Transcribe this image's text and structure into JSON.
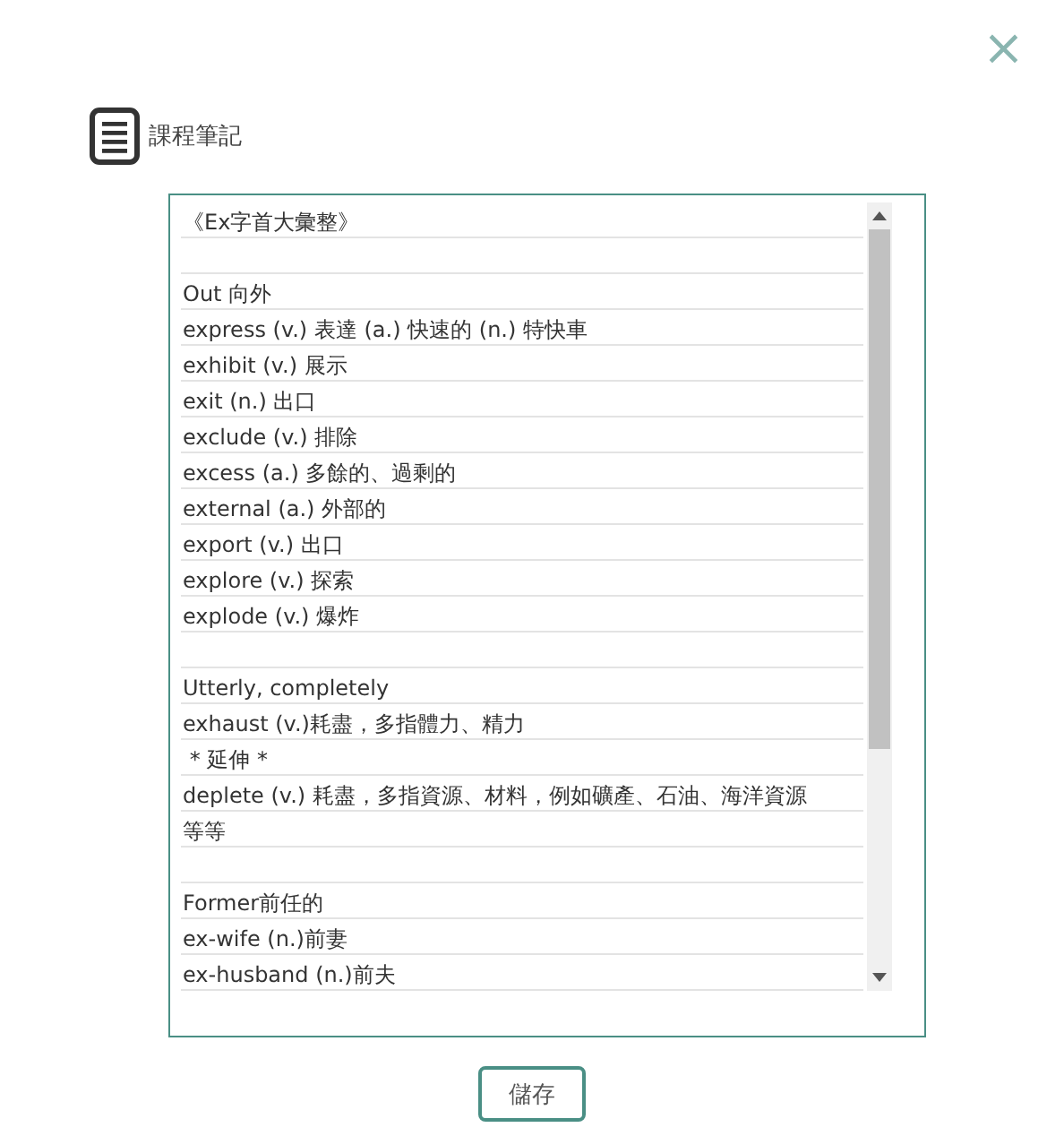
{
  "close_button": {
    "label": "×"
  },
  "header": {
    "title": "課程筆記"
  },
  "note": {
    "lines": [
      {
        "kind": "text",
        "text": "《Ex字首大彙整》"
      },
      {
        "kind": "blank"
      },
      {
        "kind": "text",
        "text": "Out 向外"
      },
      {
        "kind": "text",
        "text": "express (v.) 表達 (a.) 快速的 (n.) 特快車"
      },
      {
        "kind": "text",
        "text": "exhibit (v.) 展示"
      },
      {
        "kind": "text",
        "text": "exit (n.) 出口"
      },
      {
        "kind": "text",
        "text": "exclude (v.) 排除"
      },
      {
        "kind": "text",
        "text": "excess (a.) 多餘的、過剩的"
      },
      {
        "kind": "text",
        "text": "external (a.) 外部的"
      },
      {
        "kind": "text",
        "text": "export (v.) 出口"
      },
      {
        "kind": "text",
        "text": "explore (v.) 探索"
      },
      {
        "kind": "text",
        "text": "explode (v.) 爆炸"
      },
      {
        "kind": "blank"
      },
      {
        "kind": "text",
        "text": "Utterly, completely"
      },
      {
        "kind": "text",
        "text": "exhaust (v.)耗盡，多指體力、精力"
      },
      {
        "kind": "text",
        "text": " * 延伸 *"
      },
      {
        "kind": "text",
        "text": "deplete (v.) 耗盡，多指資源、材料，例如礦產、石油、海洋資源"
      },
      {
        "kind": "text",
        "text": "等等"
      },
      {
        "kind": "blank"
      },
      {
        "kind": "text",
        "text": "Former前任的"
      },
      {
        "kind": "text",
        "text": "ex-wife (n.)前妻"
      },
      {
        "kind": "text",
        "text": "ex-husband (n.)前夫"
      }
    ]
  },
  "save_button": {
    "label": "儲存"
  }
}
